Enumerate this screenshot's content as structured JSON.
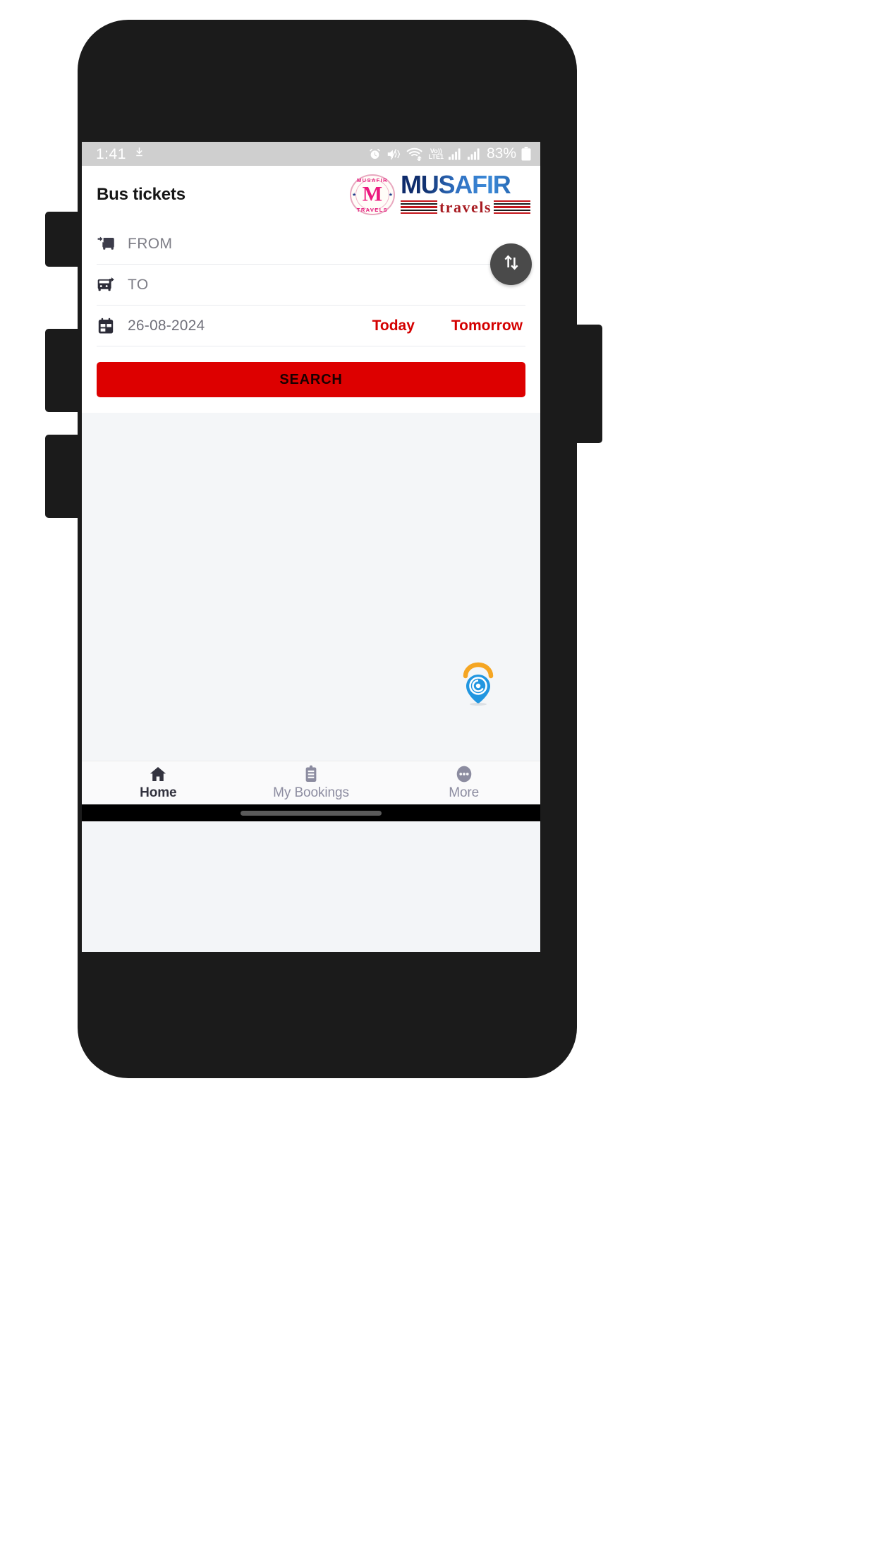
{
  "status_bar": {
    "time": "1:41",
    "download_icon": "download-icon",
    "alarm_icon": "alarm-clock-icon",
    "mute_icon": "speaker-mute-vibrate-icon",
    "wifi_icon": "wifi-data-transfer-icon",
    "volte_top": "Vo))",
    "volte_bottom": "LTE1",
    "signal_1_icon": "cellular-signal-icon",
    "signal_2_icon": "cellular-signal-icon",
    "battery_percent": "83%",
    "battery_icon": "battery-full-icon"
  },
  "header": {
    "title": "Bus tickets",
    "badge": {
      "top_text": "MUSAFIR",
      "letter": "M",
      "bottom_text": "TRAVELS",
      "star": "★"
    },
    "wordmark": {
      "primary": "MUSAFIR",
      "secondary": "travels"
    }
  },
  "search_form": {
    "from": {
      "icon": "bus-arrival-icon",
      "placeholder": "FROM",
      "value": ""
    },
    "to": {
      "icon": "bus-departure-icon",
      "placeholder": "TO",
      "value": ""
    },
    "date": {
      "icon": "calendar-icon",
      "value": "26-08-2024"
    },
    "quick_today": "Today",
    "quick_tomorrow": "Tomorrow",
    "swap_icon": "swap-vertical-arrows-icon",
    "search_label": "SEARCH"
  },
  "watermark": {
    "icon": "gps-location-pin-icon"
  },
  "bottom_nav": {
    "items": [
      {
        "label": "Home",
        "icon": "home-icon",
        "active": true
      },
      {
        "label": "My Bookings",
        "icon": "clipboard-list-icon",
        "active": false
      },
      {
        "label": "More",
        "icon": "more-dots-icon",
        "active": false
      }
    ]
  },
  "colors": {
    "accent_red": "#dd0000",
    "quick_date_red": "#d40000",
    "brand_blue": "#10306f",
    "brand_pink": "#ec1a7e",
    "nav_inactive": "#8c8ca0"
  }
}
